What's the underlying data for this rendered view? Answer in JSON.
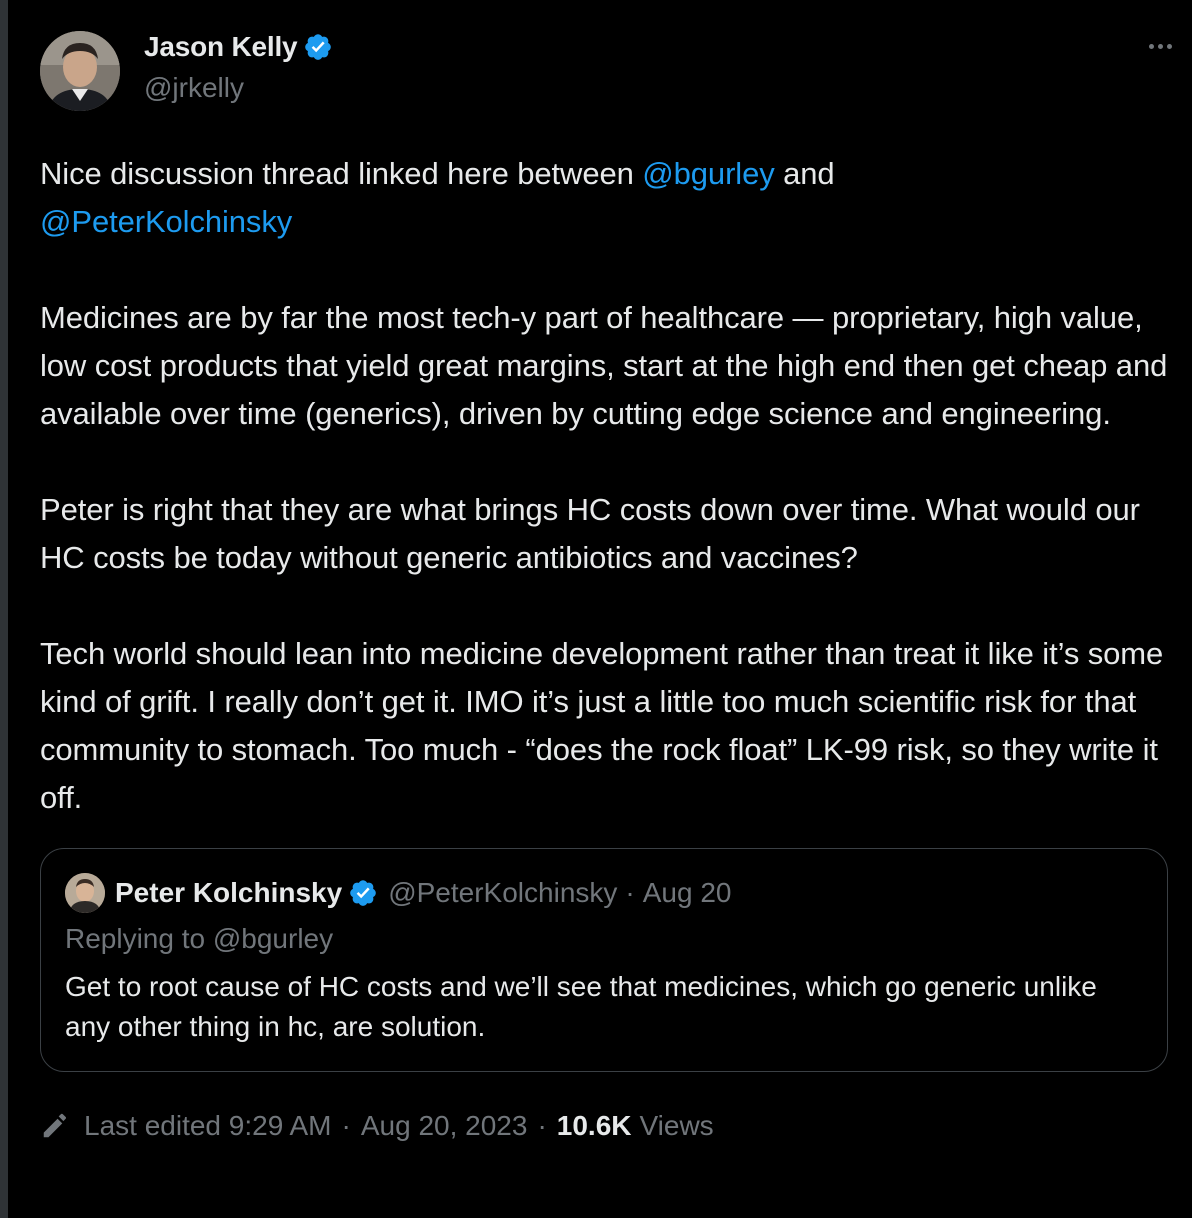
{
  "author": {
    "display_name": "Jason Kelly",
    "handle": "@jrkelly",
    "verified": true
  },
  "tweet": {
    "line1_prefix": "Nice discussion thread linked here between ",
    "mention_1": "@bgurley",
    "line1_suffix": " and",
    "mention_2": "@PeterKolchinsky",
    "paragraph_2": "Medicines are by far the most tech-y part of healthcare — proprietary, high value, low cost products that yield great margins, start at the high end then get cheap and available over time (generics), driven by cutting edge science and engineering.",
    "paragraph_3": "Peter is right that they are what brings HC costs down over time.  What would our HC costs be today without generic antibiotics and vaccines?",
    "paragraph_4": "Tech world should lean into medicine development rather than treat it like it’s some kind of grift.  I really don’t get it.  IMO it’s just a little too much scientific risk for that community to stomach. Too much - “does the rock float” LK-99 risk, so they write it off."
  },
  "quoted_tweet": {
    "display_name": "Peter Kolchinsky",
    "handle": "@PeterKolchinsky",
    "separator": "·",
    "date": "Aug 20",
    "replying_to": "Replying to @bgurley",
    "text": "Get to root cause of HC costs and we’ll see that medicines, which go generic unlike any other thing in hc, are solution."
  },
  "meta": {
    "edited_label": "Last edited 9:29 AM",
    "separator": "·",
    "date": "Aug 20, 2023",
    "views_count": "10.6K",
    "views_label": "Views"
  },
  "icons": {
    "more": "more-horizontal-icon",
    "verified": "verified-badge-icon",
    "edit": "pencil-icon"
  },
  "colors": {
    "background": "#000000",
    "text": "#e7e9ea",
    "secondary_text": "#71767b",
    "link": "#1d9bf0",
    "verified": "#1d9bf0",
    "border": "#2f3336"
  }
}
